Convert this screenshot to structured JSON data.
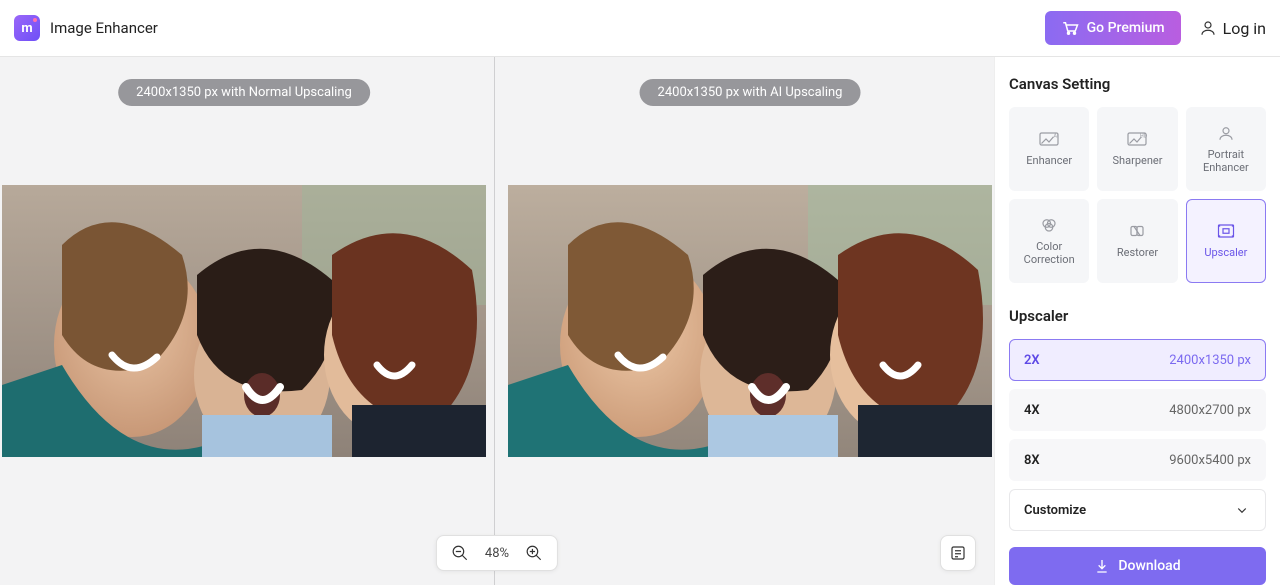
{
  "header": {
    "app_title": "Image Enhancer",
    "logo_letter": "m",
    "premium_label": "Go Premium",
    "login_label": "Log in"
  },
  "canvas": {
    "left_badge": "2400x1350 px with Normal Upscaling",
    "right_badge": "2400x1350 px with AI Upscaling",
    "zoom_level": "48%"
  },
  "sidebar": {
    "canvas_setting_title": "Canvas Setting",
    "tools": [
      {
        "label": "Enhancer"
      },
      {
        "label": "Sharpener"
      },
      {
        "label": "Portrait Enhancer"
      },
      {
        "label": "Color Correction"
      },
      {
        "label": "Restorer"
      },
      {
        "label": "Upscaler"
      }
    ],
    "section_title": "Upscaler",
    "options": [
      {
        "label": "2X",
        "dim": "2400x1350 px"
      },
      {
        "label": "4X",
        "dim": "4800x2700 px"
      },
      {
        "label": "8X",
        "dim": "9600x5400 px"
      }
    ],
    "customize_label": "Customize",
    "download_label": "Download"
  }
}
